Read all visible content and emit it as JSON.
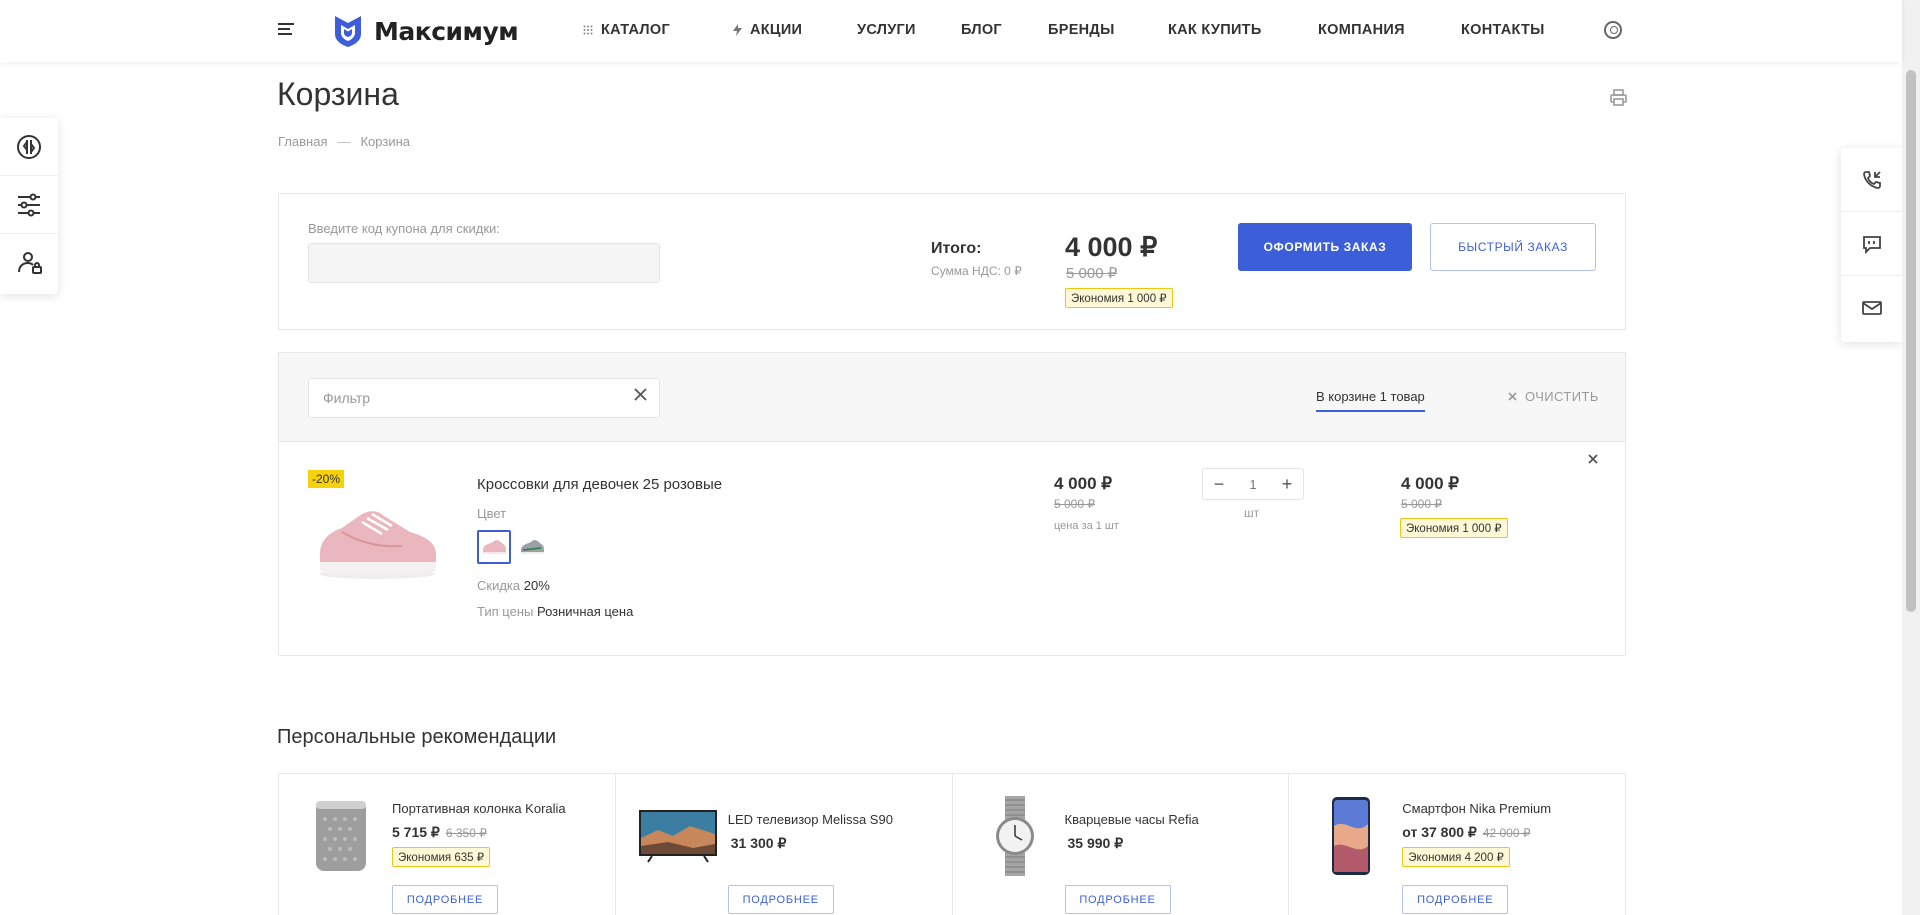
{
  "header": {
    "logo_text": "Максимум",
    "nav": [
      "КАТАЛОГ",
      "АКЦИИ",
      "УСЛУГИ",
      "БЛОГ",
      "БРЕНДЫ",
      "КАК КУПИТЬ",
      "КОМПАНИЯ",
      "КОНТАКТЫ"
    ],
    "icons": [
      "menu-icon",
      "grid-icon",
      "lightning-icon",
      "user-icon"
    ]
  },
  "left_panel": {
    "icons": [
      "compare-icon",
      "filter-sliders-icon",
      "key-icon"
    ]
  },
  "right_panel": {
    "icons": [
      "callback-phone-icon",
      "chat-icon",
      "mail-icon"
    ]
  },
  "page": {
    "title": "Корзина",
    "breadcrumb": [
      "Главная",
      "—",
      "Корзина"
    ]
  },
  "summary": {
    "coupon_label": "Введите код купона для скидки:",
    "coupon_value": "",
    "total_label": "Итого:",
    "vat": "Сумма НДС: 0 ₽",
    "total_price": "4 000 ₽",
    "total_old": "5 000 ₽",
    "total_save": "Экономия 1 000 ₽",
    "order_button": "ОФОРМИТЬ ЗАКАЗ",
    "fast_button": "БЫСТРЫЙ ЗАКАЗ"
  },
  "cart": {
    "filter_placeholder": "Фильтр",
    "in_cart": "В корзине 1 товар",
    "clear": "ОЧИСТИТЬ",
    "item": {
      "discount_tag": "-20%",
      "title": "Кроссовки для девочек 25 розовые",
      "color_label": "Цвет",
      "discount_label": "Скидка",
      "discount_value": "20%",
      "price_type_label": "Тип цены",
      "price_type_value": "Розничная цена",
      "unit_price": "4 000 ₽",
      "unit_old": "5 000 ₽",
      "unit_note": "цена за 1 шт",
      "qty": "1",
      "qty_unit": "шт",
      "sum_price": "4 000 ₽",
      "sum_old": "5 000 ₽",
      "sum_save": "Экономия 1 000 ₽"
    }
  },
  "recommendations": {
    "title": "Персональные рекомендации",
    "button": "ПОДРОБНЕЕ",
    "items": [
      {
        "name": "Портативная колонка Koralia",
        "price": "5 715 ₽",
        "old": "6 350 ₽",
        "save": "Экономия 635 ₽"
      },
      {
        "name": "LED телевизор Melissa S90",
        "price": "31 300 ₽",
        "old": "",
        "save": ""
      },
      {
        "name": "Кварцевые часы Refia",
        "price": "35 990 ₽",
        "old": "",
        "save": ""
      },
      {
        "name": "Смартфон Nika Premium",
        "price": "от 37 800 ₽",
        "old": "42 000 ₽",
        "save": "Экономия 4 200 ₽"
      }
    ]
  },
  "colors": {
    "accent": "#3c5fd9",
    "badge_yellow": "#f5d20a",
    "save_bg": "#fff8d6"
  }
}
